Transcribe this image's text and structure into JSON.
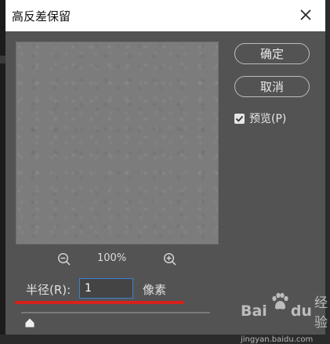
{
  "window": {
    "title": "高反差保留"
  },
  "buttons": {
    "ok_label": "确定",
    "cancel_label": "取消"
  },
  "preview_option": {
    "label": "预览(P)",
    "checked": true
  },
  "zoom": {
    "value": "100%"
  },
  "radius": {
    "label": "半径(R):",
    "value": "1",
    "unit": "像素",
    "slider_fraction": 0.0
  },
  "watermark": {
    "brand_left": "Bai",
    "brand_right": "du",
    "brand_suffix": "经验",
    "url": "jingyan.baidu.com"
  },
  "colors": {
    "dialog_bg": "#535353",
    "preview_gray": "#7c7c7c",
    "highlight_underline": "#d8211b",
    "input_focus_border": "#3d82d6"
  },
  "icons": [
    "close-icon",
    "checkmark-icon",
    "zoom-out-icon",
    "zoom-in-icon",
    "slider-thumb-icon",
    "paw-logo-icon"
  ]
}
